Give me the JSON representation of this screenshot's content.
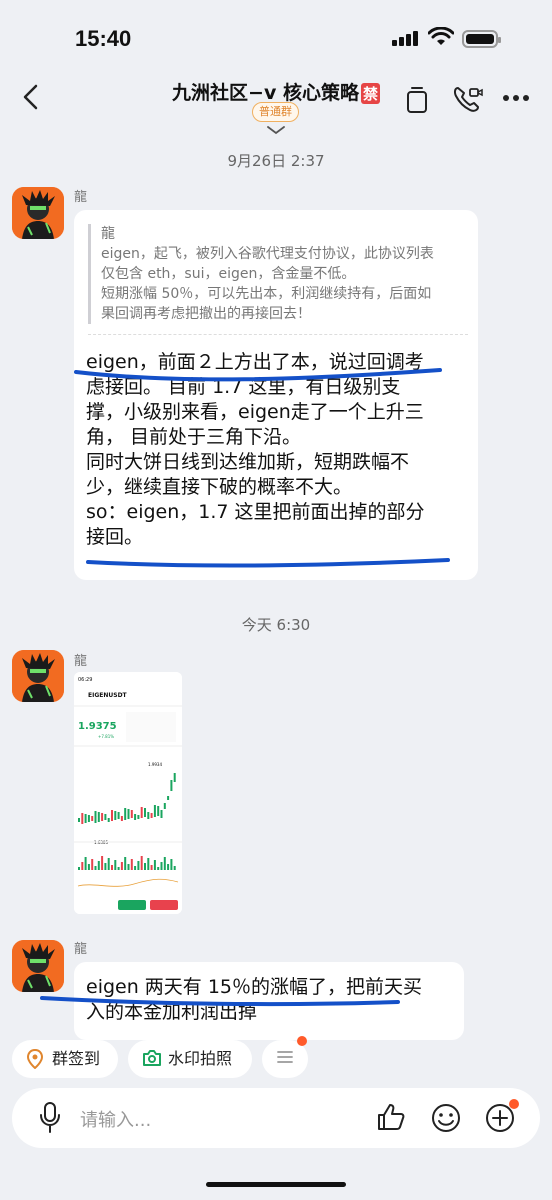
{
  "status": {
    "time": "15:40"
  },
  "header": {
    "title": "九洲社区−v 核心策略",
    "title_badge": "禁",
    "group_tag": "普通群"
  },
  "timestamps": [
    "9月26日 2:37",
    "今天 6:30"
  ],
  "messages": [
    {
      "sender": "龍",
      "quote": {
        "author": "龍",
        "lines": [
          "eigen，起飞，被列入谷歌代理支付协议，此协议列表",
          "仅包含 eth，sui，eigen，含金量不低。",
          "短期涨幅 50％，可以先出本，利润继续持有，后面如",
          "果回调再考虑把撤出的再接回去！"
        ]
      },
      "lines": [
        "eigen，前面２上方出了本，说过回调考",
        "虑接回。 目前 1.7 这里，有日级别支",
        "撑，小级别来看，eigen走了一个上升三",
        "角， 目前处于三角下沿。",
        "同时大饼日线到达维加斯，短期跌幅不",
        "少，继续直接下破的概率不大。",
        "so：eigen，1.7 这里把前面出掉的部分",
        "接回。"
      ]
    },
    {
      "sender": "龍",
      "image": {
        "time": "06:29",
        "pair": "EIGENUSDT",
        "price": "1.9375",
        "change": "+7.81%",
        "peak": "1.9934",
        "low": "1.6305"
      }
    },
    {
      "sender": "龍",
      "lines": [
        "eigen 两天有 15％的涨幅了，把前天买",
        "入的本金加利润出掉"
      ]
    }
  ],
  "quick_actions": [
    {
      "label": "群签到",
      "icon": "location-pin-icon"
    },
    {
      "label": "水印拍照",
      "icon": "camera-icon"
    },
    {
      "label": "",
      "icon": "menu-lines-icon"
    }
  ],
  "input": {
    "placeholder": "请输入..."
  },
  "colors": {
    "accent_orange": "#ff5a2a",
    "annotation_blue": "#1450c8",
    "badge_red": "#e64545",
    "buy_green": "#1aa55f",
    "sell_red": "#e8424d"
  }
}
